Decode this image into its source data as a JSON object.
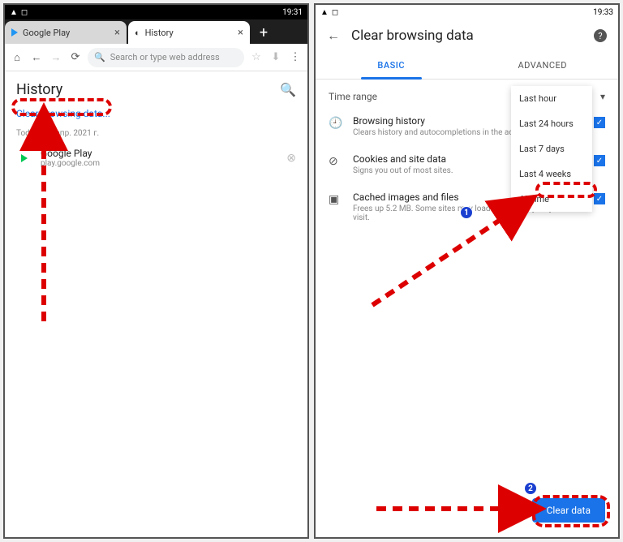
{
  "left": {
    "status_time": "19:31",
    "tabs": {
      "inactive": {
        "label": "Google Play"
      },
      "active": {
        "label": "History"
      }
    },
    "omnibox_placeholder": "Search or type web address",
    "history_title": "History",
    "clear_link": "Clear browsing data...",
    "date_header": "Today - 29 апр. 2021 г.",
    "item": {
      "title": "Google Play",
      "url": "play.google.com"
    }
  },
  "right": {
    "status_time": "19:33",
    "header": "Clear browsing data",
    "tab_basic": "BASIC",
    "tab_advanced": "ADVANCED",
    "time_range_label": "Time range",
    "dropdown_options": {
      "hour": "Last hour",
      "day": "Last 24 hours",
      "week": "Last 7 days",
      "month": "Last 4 weeks",
      "all": "All time"
    },
    "s1": {
      "title": "Browsing history",
      "desc": "Clears history and autocompletions in the address bar."
    },
    "s2": {
      "title": "Cookies and site data",
      "desc": "Signs you out of most sites."
    },
    "s3": {
      "title": "Cached images and files",
      "desc": "Frees up 5.2 MB. Some sites may load more slowly on your next visit."
    },
    "clear_button": "Clear data"
  },
  "annotations": {
    "badge1": "1",
    "badge2": "2"
  }
}
